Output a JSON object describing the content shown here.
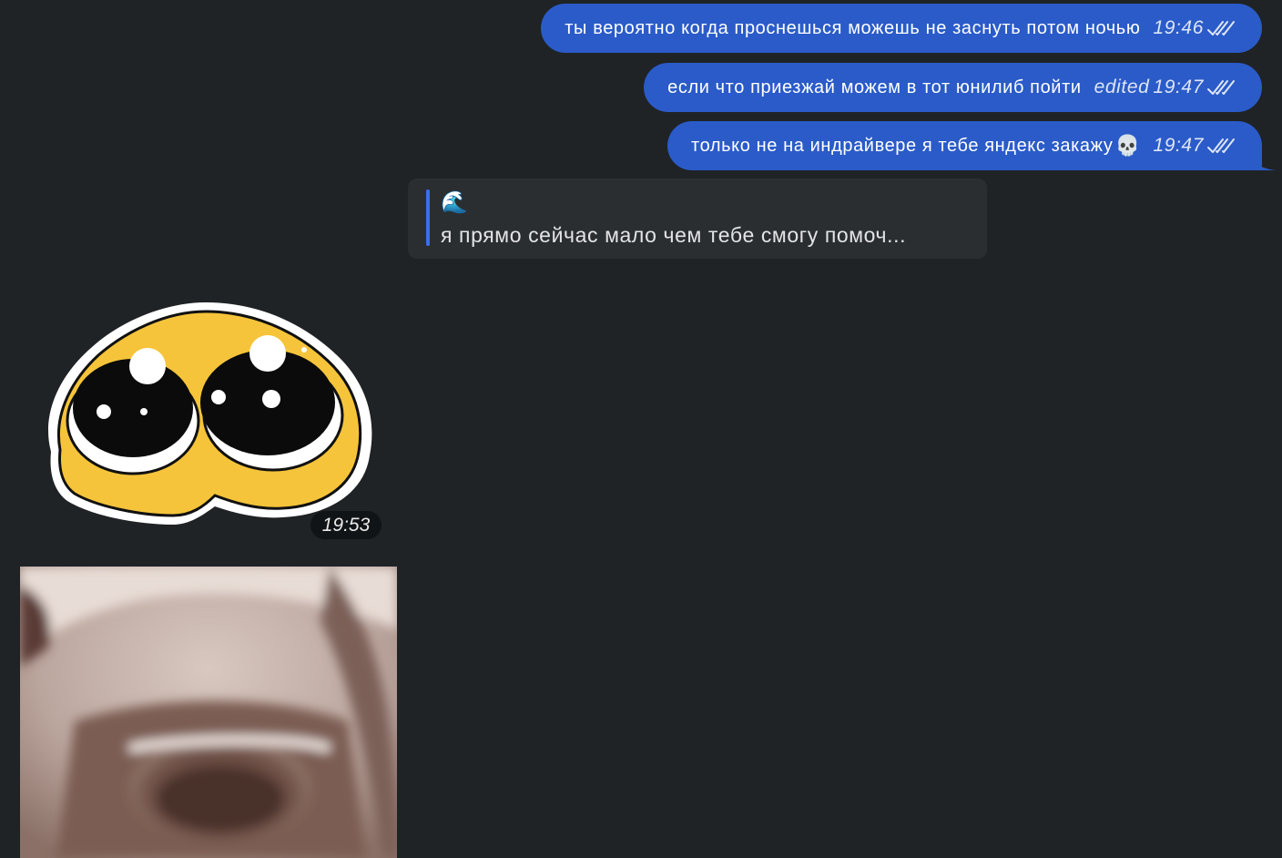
{
  "messages_out": [
    {
      "text": "ты вероятно когда проснешься можешь не заснуть потом ночью",
      "time": "19:46",
      "edited": ""
    },
    {
      "text": "если что приезжай можем в тот юнилиб пойти",
      "time": "19:47",
      "edited": "edited"
    },
    {
      "text": "только не на индрайвере я тебе яндекс закажу",
      "emoji": "💀",
      "time": "19:47",
      "edited": ""
    }
  ],
  "reply": {
    "emoji": "🌊",
    "text": "я прямо сейчас мало чем тебе смогу помоч..."
  },
  "sticker": {
    "time": "19:53",
    "icon": "pleading-face-sticker"
  },
  "photo": {
    "icon": "blurry-photo"
  },
  "colors": {
    "background": "#1f2326",
    "outgoing_bubble": "#2a5bc8",
    "reply_card": "#2b2e31",
    "reply_bar": "#3a6ef0"
  }
}
